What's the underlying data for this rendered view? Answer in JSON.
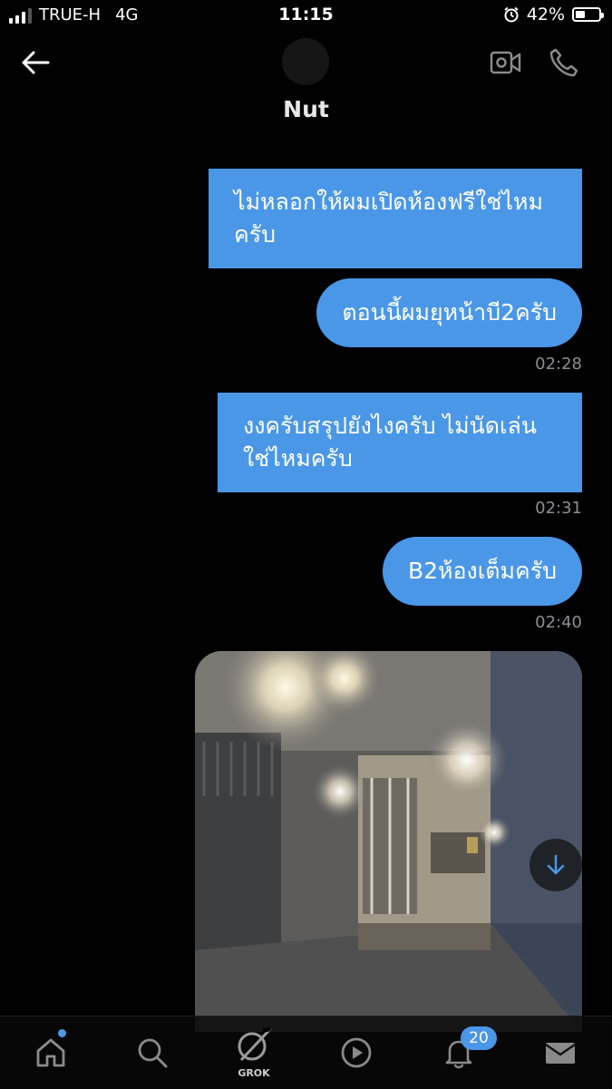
{
  "status_bar": {
    "carrier": "TRUE-H",
    "network": "4G",
    "time": "11:15",
    "battery_percent": "42%",
    "battery_level": 0.42,
    "signal_bars": 3
  },
  "header": {
    "contact_name": "Nut",
    "icons": [
      "back-arrow-icon",
      "video-camera-icon",
      "phone-icon"
    ]
  },
  "messages": [
    {
      "text_line1": "ไม่หลอกให้ผมเปิดห้องฟรีใช่ไหม",
      "text_line2": "ครับ"
    },
    {
      "text": "ตอนนี้ผมยุหน้าบี2ครับ",
      "time": "02:28"
    },
    {
      "text_line1": "งงครับสรุปยังไงครับ ไม่นัดเล่น",
      "text_line2": "ใช่ไหมครับ",
      "time": "02:31"
    },
    {
      "text": "B2ห้องเต็มครับ",
      "time": "02:40"
    }
  ],
  "tab_bar": {
    "items": [
      "home-icon",
      "search-icon",
      "grok-icon",
      "video-icon",
      "notifications-icon",
      "messages-icon"
    ],
    "grok_label": "GROK",
    "notification_count": "20"
  },
  "colors": {
    "bubble": "#4a97e8",
    "background": "#000000",
    "timestamp": "#8b8f94"
  }
}
